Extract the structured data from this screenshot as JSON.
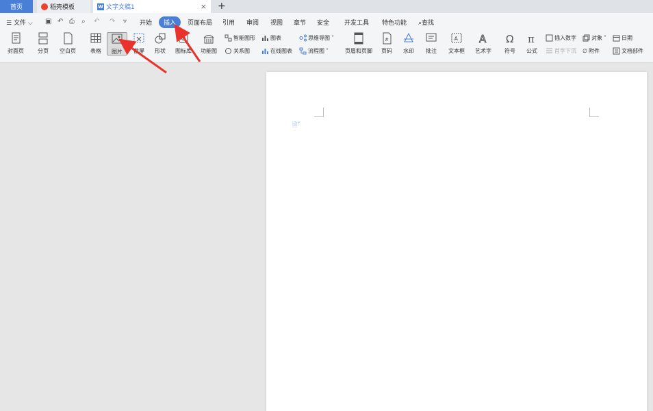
{
  "tabs": {
    "home": "首页",
    "template": "稻壳模板",
    "document": "文字文稿1",
    "close": "×",
    "add": "+"
  },
  "menu": {
    "file": "文件",
    "items": [
      "开始",
      "插入",
      "页面布局",
      "引用",
      "审阅",
      "视图",
      "章节",
      "安全",
      "开发工具",
      "特色功能"
    ],
    "search": "查找"
  },
  "ribbon": {
    "cover": "封面页",
    "section": "分页",
    "blank": "空白页",
    "table": "表格",
    "picture": "图片",
    "screenshot": "截屏",
    "shape": "形状",
    "iconlib": "图标库",
    "funcchart": "功能图",
    "smartart": "智能图形",
    "chart": "图表",
    "mindmap": "思维导图",
    "relation": "关系图",
    "onlinechart": "在线图表",
    "flowchart": "流程图",
    "headerfooter": "页眉和页脚",
    "pagenum": "页码",
    "watermark": "水印",
    "comment": "批注",
    "textbox": "文本框",
    "wordart": "艺术字",
    "symbol": "符号",
    "formula": "公式",
    "insertnum": "插入数字",
    "object": "对象",
    "date": "日期",
    "dropcap": "首字下沉",
    "attachment": "附件",
    "docparts": "文档部件"
  },
  "colors": {
    "accent": "#4a7fd8",
    "arrow": "#e8322b",
    "page": "#ffffff",
    "canvas": "#e6e6e6"
  }
}
